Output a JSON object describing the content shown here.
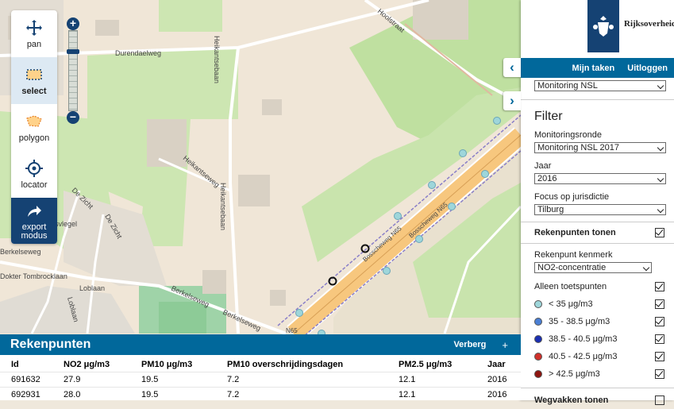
{
  "toolbar": {
    "pan": "pan",
    "select": "select",
    "polygon": "polygon",
    "locator": "locator",
    "export": "export modus"
  },
  "header": {
    "brand": "Rijksoverheid",
    "nav": [
      "Mijn taken",
      "Uitloggen"
    ]
  },
  "panel": {
    "top_select": "Monitoring NSL",
    "filter_title": "Filter",
    "monitoringsronde_label": "Monitoringsronde",
    "monitoringsronde_value": "Monitoring NSL 2017",
    "jaar_label": "Jaar",
    "jaar_value": "2016",
    "focus_label": "Focus op jurisdictie",
    "focus_value": "Tilburg",
    "rekenpunten_tonen": "Rekenpunten tonen",
    "kenmerk_label": "Rekenpunt kenmerk",
    "kenmerk_value": "NO2-concentratie",
    "alleen_toetspunten": "Alleen toetspunten",
    "legend": [
      {
        "label": "< 35 μg/m3",
        "color": "#9ed6da"
      },
      {
        "label": "35 - 38.5 μg/m3",
        "color": "#4a7fd4"
      },
      {
        "label": "38.5 - 40.5 μg/m3",
        "color": "#1b2fb2"
      },
      {
        "label": "40.5 - 42.5 μg/m3",
        "color": "#d0302a"
      },
      {
        "label": "> 42.5 μg/m3",
        "color": "#8e1510"
      }
    ],
    "wegvakken_tonen": "Wegvakken tonen"
  },
  "map_labels": {
    "durendaelweg": "Durendaelweg",
    "hoolstraat": "Hoolstraat",
    "heikantseweg": "Heikantseweg",
    "heikantsebaan": "Heikantsebaan",
    "bosscheweg1": "Bosscheweg N65",
    "bosscheweg2": "Bosscheweg N65",
    "dezicht1": "De Zicht",
    "dezicht2": "De Zicht",
    "korsvlegel": "Korsvlegel",
    "berkelseweg1": "Berkelseweg",
    "berkelseweg2": "Berkelseweg",
    "berkelseweg3": "Berkelseweg",
    "tombrocklaan": "Dokter Tombrocklaan",
    "loblaan1": "Loblaan",
    "loblaan2": "Loblaan",
    "n65": "N65"
  },
  "table": {
    "title": "Rekenpunten",
    "hide": "Verberg",
    "plus": "+",
    "headers": [
      "Id",
      "NO2 μg/m3",
      "PM10 μg/m3",
      "PM10 overschrijdingsdagen",
      "PM2.5 μg/m3",
      "Jaar"
    ],
    "rows": [
      [
        "691632",
        "27.9",
        "19.5",
        "7.2",
        "12.1",
        "2016"
      ],
      [
        "692931",
        "28.0",
        "19.5",
        "7.2",
        "12.1",
        "2016"
      ]
    ]
  },
  "colors": {
    "brand": "#154273",
    "accent": "#01689b",
    "road": "#f7c77e"
  }
}
